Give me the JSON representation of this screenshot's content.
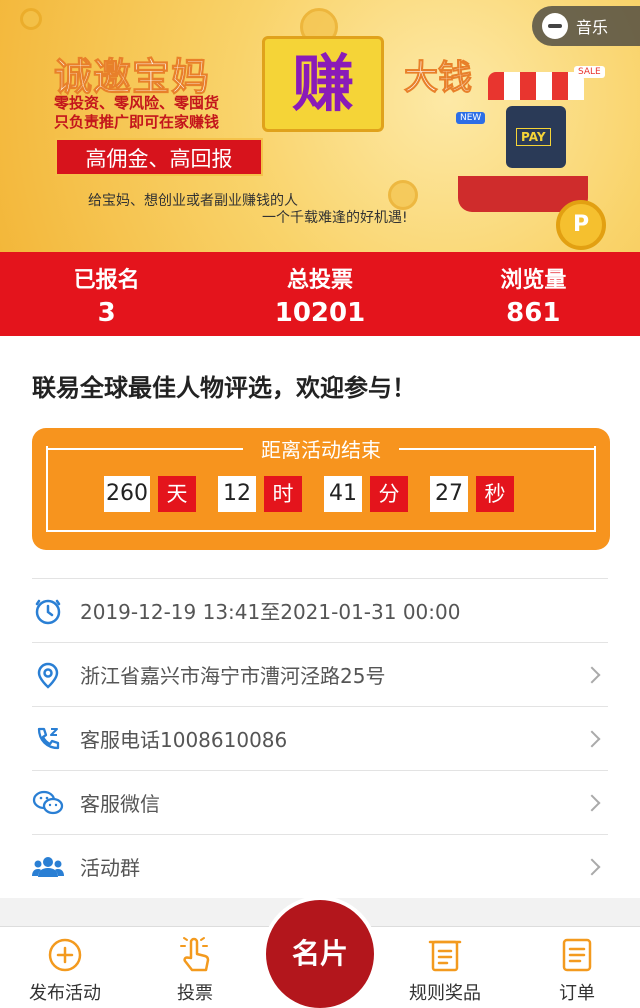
{
  "banner": {
    "title_left": "诚邀宝妈",
    "title_earn": "赚",
    "title_right": "大钱",
    "sub_lines": [
      "零投资、零风险、零囤货",
      "只负责推广即可在家赚钱"
    ],
    "red_tag": "高佣金、高回报",
    "desc_line1": "给宝妈、想创业或者副业赚钱的人",
    "desc_line2": "一个千载难逢的好机遇!",
    "music_label": "音乐",
    "pay_label": "PAY",
    "sale_label": "SALE",
    "new_label": "NEW",
    "coin_label": "P"
  },
  "stats": [
    {
      "label": "已报名",
      "value": "3"
    },
    {
      "label": "总投票",
      "value": "10201"
    },
    {
      "label": "浏览量",
      "value": "861"
    }
  ],
  "event": {
    "title": "联易全球最佳人物评选，欢迎参与！"
  },
  "countdown": {
    "title": "距离活动结束",
    "days": "260",
    "days_unit": "天",
    "hours": "12",
    "hours_unit": "时",
    "minutes": "41",
    "minutes_unit": "分",
    "seconds": "27",
    "seconds_unit": "秒"
  },
  "info": {
    "time_range": "2019-12-19 13:41至2021-01-31 00:00",
    "address": "浙江省嘉兴市海宁市漕河泾路25号",
    "phone": "客服电话1008610086",
    "wechat": "客服微信",
    "group": "活动群"
  },
  "nav": {
    "publish": "发布活动",
    "vote": "投票",
    "card": "名片",
    "rules": "规则奖品",
    "orders": "订单"
  },
  "colors": {
    "brand_red": "#e4141c",
    "countdown_orange": "#f7941e",
    "icon_blue": "#2a7fd4",
    "nav_orange": "#f39a1e"
  }
}
